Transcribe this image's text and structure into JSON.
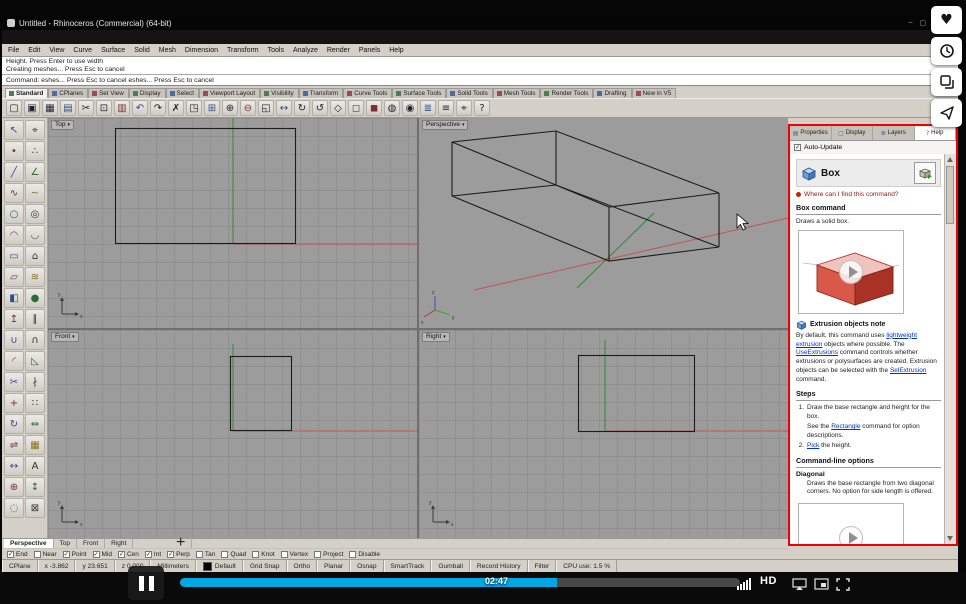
{
  "window": {
    "title": "Untitled - Rhinoceros (Commercial) (64-bit)",
    "minimize": "–",
    "maximize": "▢",
    "close": "✕"
  },
  "menubar": {
    "items": [
      {
        "label": "File"
      },
      {
        "label": "Edit"
      },
      {
        "label": "View"
      },
      {
        "label": "Curve"
      },
      {
        "label": "Surface"
      },
      {
        "label": "Solid"
      },
      {
        "label": "Mesh"
      },
      {
        "label": "Dimension"
      },
      {
        "label": "Transform"
      },
      {
        "label": "Tools"
      },
      {
        "label": "Analyze"
      },
      {
        "label": "Render"
      },
      {
        "label": "Panels"
      },
      {
        "label": "Help"
      }
    ]
  },
  "command_area": {
    "history_1": "Height. Press Enter to use width",
    "history_2": "Creating meshes... Press Esc to cancel",
    "prompt": "Command: eshes... Press Esc to cancel eshes... Press Esc to cancel"
  },
  "toolbar_tabs": {
    "items": [
      {
        "label": "Standard",
        "state": "active"
      },
      {
        "label": "CPlanes",
        "state": ""
      },
      {
        "label": "Set View",
        "state": ""
      },
      {
        "label": "Display",
        "state": ""
      },
      {
        "label": "Select",
        "state": ""
      },
      {
        "label": "Viewport Layout",
        "state": ""
      },
      {
        "label": "Visibility",
        "state": ""
      },
      {
        "label": "Transform",
        "state": ""
      },
      {
        "label": "Curve Tools",
        "state": ""
      },
      {
        "label": "Surface Tools",
        "state": ""
      },
      {
        "label": "Solid Tools",
        "state": ""
      },
      {
        "label": "Mesh Tools",
        "state": ""
      },
      {
        "label": "Render Tools",
        "state": ""
      },
      {
        "label": "Drafting",
        "state": ""
      },
      {
        "label": "New in V5",
        "state": ""
      }
    ]
  },
  "toolbar_icons": {
    "items": [
      {
        "name": "new-file-icon",
        "glyph": "▢"
      },
      {
        "name": "open-file-icon",
        "glyph": "▣"
      },
      {
        "name": "save-icon",
        "glyph": "▦"
      },
      {
        "name": "print-icon",
        "glyph": "▤"
      },
      {
        "name": "cut-icon",
        "glyph": "✂"
      },
      {
        "name": "copy-icon",
        "glyph": "⊡"
      },
      {
        "name": "paste-icon",
        "glyph": "▥"
      },
      {
        "name": "undo-icon",
        "glyph": "↶"
      },
      {
        "name": "redo-icon",
        "glyph": "↷"
      },
      {
        "name": "delete-icon",
        "glyph": "✗"
      },
      {
        "name": "select-filter-icon",
        "glyph": "◳"
      },
      {
        "name": "zoom-extents-icon",
        "glyph": "⊞"
      },
      {
        "name": "zoom-in-icon",
        "glyph": "⊕"
      },
      {
        "name": "zoom-out-icon",
        "glyph": "⊖"
      },
      {
        "name": "zoom-window-icon",
        "glyph": "◱"
      },
      {
        "name": "pan-icon",
        "glyph": "↔"
      },
      {
        "name": "rotate-view-icon",
        "glyph": "↻"
      },
      {
        "name": "undo-view-icon",
        "glyph": "↺"
      },
      {
        "name": "named-views-icon",
        "glyph": "◇"
      },
      {
        "name": "wireframe-display-icon",
        "glyph": "◻"
      },
      {
        "name": "shaded-display-icon",
        "glyph": "◼"
      },
      {
        "name": "render-icon",
        "glyph": "◍"
      },
      {
        "name": "render-preview-icon",
        "glyph": "◉"
      },
      {
        "name": "layers-icon",
        "glyph": "≣"
      },
      {
        "name": "object-properties-icon",
        "glyph": "≡"
      },
      {
        "name": "osnap-toggle-icon",
        "glyph": "⌖"
      },
      {
        "name": "help-icon",
        "glyph": "?"
      }
    ]
  },
  "tool_palette": {
    "items": [
      {
        "name": "pointer-tool-icon",
        "glyph": "↖"
      },
      {
        "name": "selection-filter-tool-icon",
        "glyph": "⌖"
      },
      {
        "name": "point-tool-icon",
        "glyph": "•"
      },
      {
        "name": "point-cloud-tool-icon",
        "glyph": "∴"
      },
      {
        "name": "line-tool-icon",
        "glyph": "╱"
      },
      {
        "name": "polyline-tool-icon",
        "glyph": "∠"
      },
      {
        "name": "curve-tool-icon",
        "glyph": "∿"
      },
      {
        "name": "handle-curve-tool-icon",
        "glyph": "~"
      },
      {
        "name": "circle-tool-icon",
        "glyph": "○"
      },
      {
        "name": "ellipse-tool-icon",
        "glyph": "◎"
      },
      {
        "name": "arc-tool-icon",
        "glyph": "◠"
      },
      {
        "name": "arc-3pt-tool-icon",
        "glyph": "◡"
      },
      {
        "name": "rectangle-tool-icon",
        "glyph": "▭"
      },
      {
        "name": "polygon-tool-icon",
        "glyph": "⌂"
      },
      {
        "name": "plane-tool-icon",
        "glyph": "▱"
      },
      {
        "name": "loft-tool-icon",
        "glyph": "≋"
      },
      {
        "name": "box-tool-icon",
        "glyph": "◧"
      },
      {
        "name": "sphere-tool-icon",
        "glyph": "●"
      },
      {
        "name": "extrude-tool-icon",
        "glyph": "↥"
      },
      {
        "name": "pipe-tool-icon",
        "glyph": "∥"
      },
      {
        "name": "boolean-union-tool-icon",
        "glyph": "∪"
      },
      {
        "name": "boolean-intersect-tool-icon",
        "glyph": "∩"
      },
      {
        "name": "fillet-tool-icon",
        "glyph": "◜"
      },
      {
        "name": "chamfer-tool-icon",
        "glyph": "◺"
      },
      {
        "name": "trim-tool-icon",
        "glyph": "✂"
      },
      {
        "name": "split-tool-icon",
        "glyph": "∤"
      },
      {
        "name": "move-tool-icon",
        "glyph": "+"
      },
      {
        "name": "copy-object-tool-icon",
        "glyph": "∷"
      },
      {
        "name": "rotate-tool-icon",
        "glyph": "↻"
      },
      {
        "name": "scale-tool-icon",
        "glyph": "⇔"
      },
      {
        "name": "mirror-tool-icon",
        "glyph": "⇌"
      },
      {
        "name": "array-tool-icon",
        "glyph": "▦"
      },
      {
        "name": "dimension-tool-icon",
        "glyph": "↔"
      },
      {
        "name": "text-tool-icon",
        "glyph": "A"
      },
      {
        "name": "zoom-tool-icon",
        "glyph": "⊕"
      },
      {
        "name": "pan-view-tool-icon",
        "glyph": "↕"
      },
      {
        "name": "hide-tool-icon",
        "glyph": "◌"
      },
      {
        "name": "lock-tool-icon",
        "glyph": "⊠"
      }
    ]
  },
  "viewports": {
    "arrow": "▾",
    "top_label": "Top",
    "perspective_label": "Perspective",
    "front_label": "Front",
    "right_label": "Right",
    "axis_x": "x",
    "axis_y": "y",
    "axis_z": "z"
  },
  "viewport_tabs": {
    "new_tab": "+",
    "items": [
      {
        "label": "Perspective",
        "state": "active"
      },
      {
        "label": "Top",
        "state": ""
      },
      {
        "label": "Front",
        "state": ""
      },
      {
        "label": "Right",
        "state": ""
      }
    ]
  },
  "osnap": {
    "items": [
      {
        "label": "End",
        "mark": "✓"
      },
      {
        "label": "Near",
        "mark": ""
      },
      {
        "label": "Point",
        "mark": "✓"
      },
      {
        "label": "Mid",
        "mark": "✓"
      },
      {
        "label": "Cen",
        "mark": "✓"
      },
      {
        "label": "Int",
        "mark": "✓"
      },
      {
        "label": "Perp",
        "mark": "✓"
      },
      {
        "label": "Tan",
        "mark": ""
      },
      {
        "label": "Quad",
        "mark": ""
      },
      {
        "label": "Knot",
        "mark": ""
      },
      {
        "label": "Vertex",
        "mark": ""
      },
      {
        "label": "Project",
        "mark": ""
      },
      {
        "label": "Disable",
        "mark": ""
      }
    ]
  },
  "statusbar": {
    "cells": [
      {
        "text": "CPlane"
      },
      {
        "text": "x -3.862"
      },
      {
        "text": "y 23.651"
      },
      {
        "text": "z 0.000"
      },
      {
        "text": "Millimeters"
      }
    ],
    "layer_name": "Default",
    "toggles": [
      {
        "label": "Grid Snap"
      },
      {
        "label": "Ortho"
      },
      {
        "label": "Planar"
      },
      {
        "label": "Osnap"
      },
      {
        "label": "SmartTrack"
      },
      {
        "label": "Gumball"
      },
      {
        "label": "Record History"
      },
      {
        "label": "Filter"
      }
    ],
    "cpu": "CPU use: 1.5 %"
  },
  "panel": {
    "tabs": [
      {
        "label": "Properties",
        "glyph": "▤",
        "state": ""
      },
      {
        "label": "Display",
        "glyph": "▢",
        "state": ""
      },
      {
        "label": "Layers",
        "glyph": "≣",
        "state": ""
      },
      {
        "label": "Help",
        "glyph": "?",
        "state": "active"
      }
    ],
    "auto_update_label": "Auto-Update",
    "auto_update_mark": "✓",
    "command_name": "Box",
    "find_link": "Where can I find this command?",
    "box_heading": "Box command",
    "box_desc": "Draws a solid box.",
    "note_heading": "Extrusion objects note",
    "note_segments": [
      {
        "text": "By default, this command uses ",
        "link": "",
        "ia": "false"
      },
      {
        "text": "lightweight extrusion",
        "link": "y",
        "ia": "true"
      },
      {
        "text": " objects where possible. The ",
        "link": "",
        "ia": "false"
      },
      {
        "text": "UseExtrusions",
        "link": "y",
        "ia": "true"
      },
      {
        "text": " command controls whether extrusions or polysurfaces are created. Extrusion objects can be selected with the ",
        "link": "",
        "ia": "false"
      },
      {
        "text": "SelExtrusion",
        "link": "y",
        "ia": "true"
      },
      {
        "text": " command.",
        "link": "",
        "ia": "false"
      }
    ],
    "steps_heading": "Steps",
    "step1_num": "1.",
    "step1_segments": [
      {
        "text": "Draw the base rectangle and height for the box.",
        "link": "",
        "ia": "false"
      }
    ],
    "step1b_segments": [
      {
        "text": "See the ",
        "link": "",
        "ia": "false"
      },
      {
        "text": "Rectangle",
        "link": "y",
        "ia": "true"
      },
      {
        "text": " command for option descriptions.",
        "link": "",
        "ia": "false"
      }
    ],
    "step2_num": "2.",
    "step2_segments": [
      {
        "text": "Pick",
        "link": "y",
        "ia": "true"
      },
      {
        "text": " the height.",
        "link": "",
        "ia": "false"
      }
    ],
    "options_heading": "Command-line options",
    "option_name": "Diagonal",
    "option_desc": "Draws the base rectangle from two diagonal corners. No option for side length is offered."
  },
  "player": {
    "time": "02:47",
    "hd": "HD"
  },
  "colors": {
    "accent": "#00a7e5",
    "highlight": "#f00000",
    "link": "#0033cc"
  }
}
